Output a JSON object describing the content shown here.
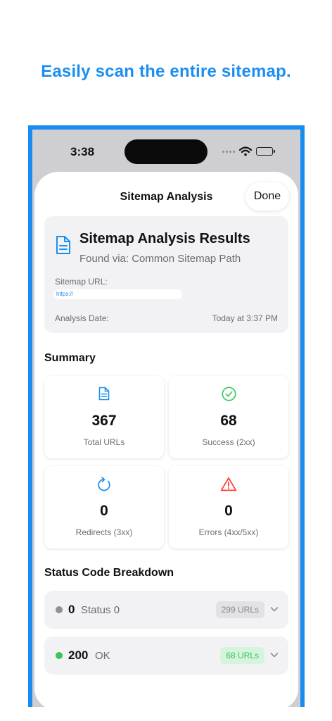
{
  "headline": "Easily scan the entire sitemap.",
  "status_bar": {
    "time": "3:38"
  },
  "nav": {
    "title": "Sitemap Analysis",
    "done_label": "Done"
  },
  "results": {
    "title": "Sitemap Analysis Results",
    "found_via": "Found via: Common Sitemap Path",
    "url_label": "Sitemap URL:",
    "url_value": "https://",
    "date_label": "Analysis Date:",
    "date_value": "Today at 3:37 PM"
  },
  "summary": {
    "title": "Summary",
    "cards": [
      {
        "value": "367",
        "label": "Total URLs",
        "icon": "document-icon",
        "color": "#1c8ef0"
      },
      {
        "value": "68",
        "label": "Success (2xx)",
        "icon": "checkmark-circle-icon",
        "color": "#34c759"
      },
      {
        "value": "0",
        "label": "Redirects (3xx)",
        "icon": "refresh-icon",
        "color": "#1c8ef0"
      },
      {
        "value": "0",
        "label": "Errors (4xx/5xx)",
        "icon": "warning-icon",
        "color": "#ff3b30"
      }
    ]
  },
  "breakdown": {
    "title": "Status Code Breakdown",
    "rows": [
      {
        "code": "0",
        "desc": "Status 0",
        "badge": "299 URLs",
        "dot_color": "#8e8e93",
        "badge_bg": "#e2e2e6",
        "badge_color": "#8a8a8e"
      },
      {
        "code": "200",
        "desc": "OK",
        "badge": "68 URLs",
        "dot_color": "#34c759",
        "badge_bg": "#d6f3dd",
        "badge_color": "#34c759"
      }
    ]
  },
  "colors": {
    "accent": "#1c8ef0",
    "frame": "#1a8cf0",
    "success": "#34c759",
    "error": "#ff3b30"
  }
}
